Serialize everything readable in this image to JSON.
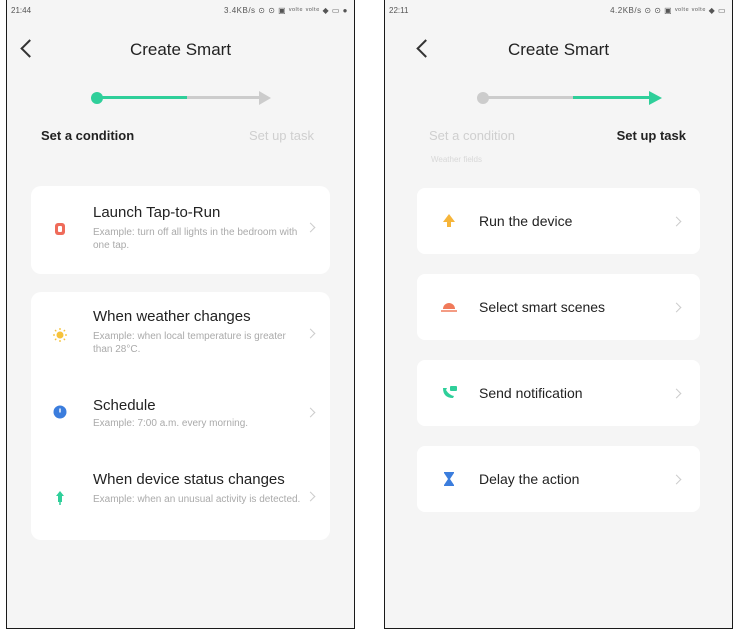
{
  "left": {
    "status": {
      "time": "21:44",
      "icons": "3.4KB/s ⊙ ⊙ ▣ ᵛᵒˡᵗᵉ ᵛᵒˡᵗᵉ ◆ ▭ ●"
    },
    "title": "Create Smart",
    "steps": {
      "active": "Set a condition",
      "inactive": "Set up task"
    },
    "options": [
      {
        "title": "Launch Tap-to-Run",
        "desc": "Example: turn off all lights in the bedroom with one tap."
      },
      {
        "title": "When weather changes",
        "desc": "Example: when local temperature is greater than 28°C."
      },
      {
        "title": "Schedule",
        "desc": "Example: 7:00 a.m. every morning."
      },
      {
        "title": "When device status changes",
        "desc": "Example: when an unusual activity is detected."
      }
    ]
  },
  "right": {
    "status": {
      "time": "22:11",
      "icons": "4.2KB/s ⊙ ⊙ ▣ ᵛᵒˡᵗᵉ ᵛᵒˡᵗᵉ ◆ ▭"
    },
    "title": "Create Smart",
    "steps": {
      "inactive": "Set a condition",
      "active": "Set up task"
    },
    "hint": "Weather fields",
    "tasks": [
      {
        "title": "Run the device"
      },
      {
        "title": "Select smart scenes"
      },
      {
        "title": "Send notification"
      },
      {
        "title": "Delay the action"
      }
    ]
  },
  "colors": {
    "accent": "#2fcf9a",
    "inactive": "#cccccc"
  }
}
